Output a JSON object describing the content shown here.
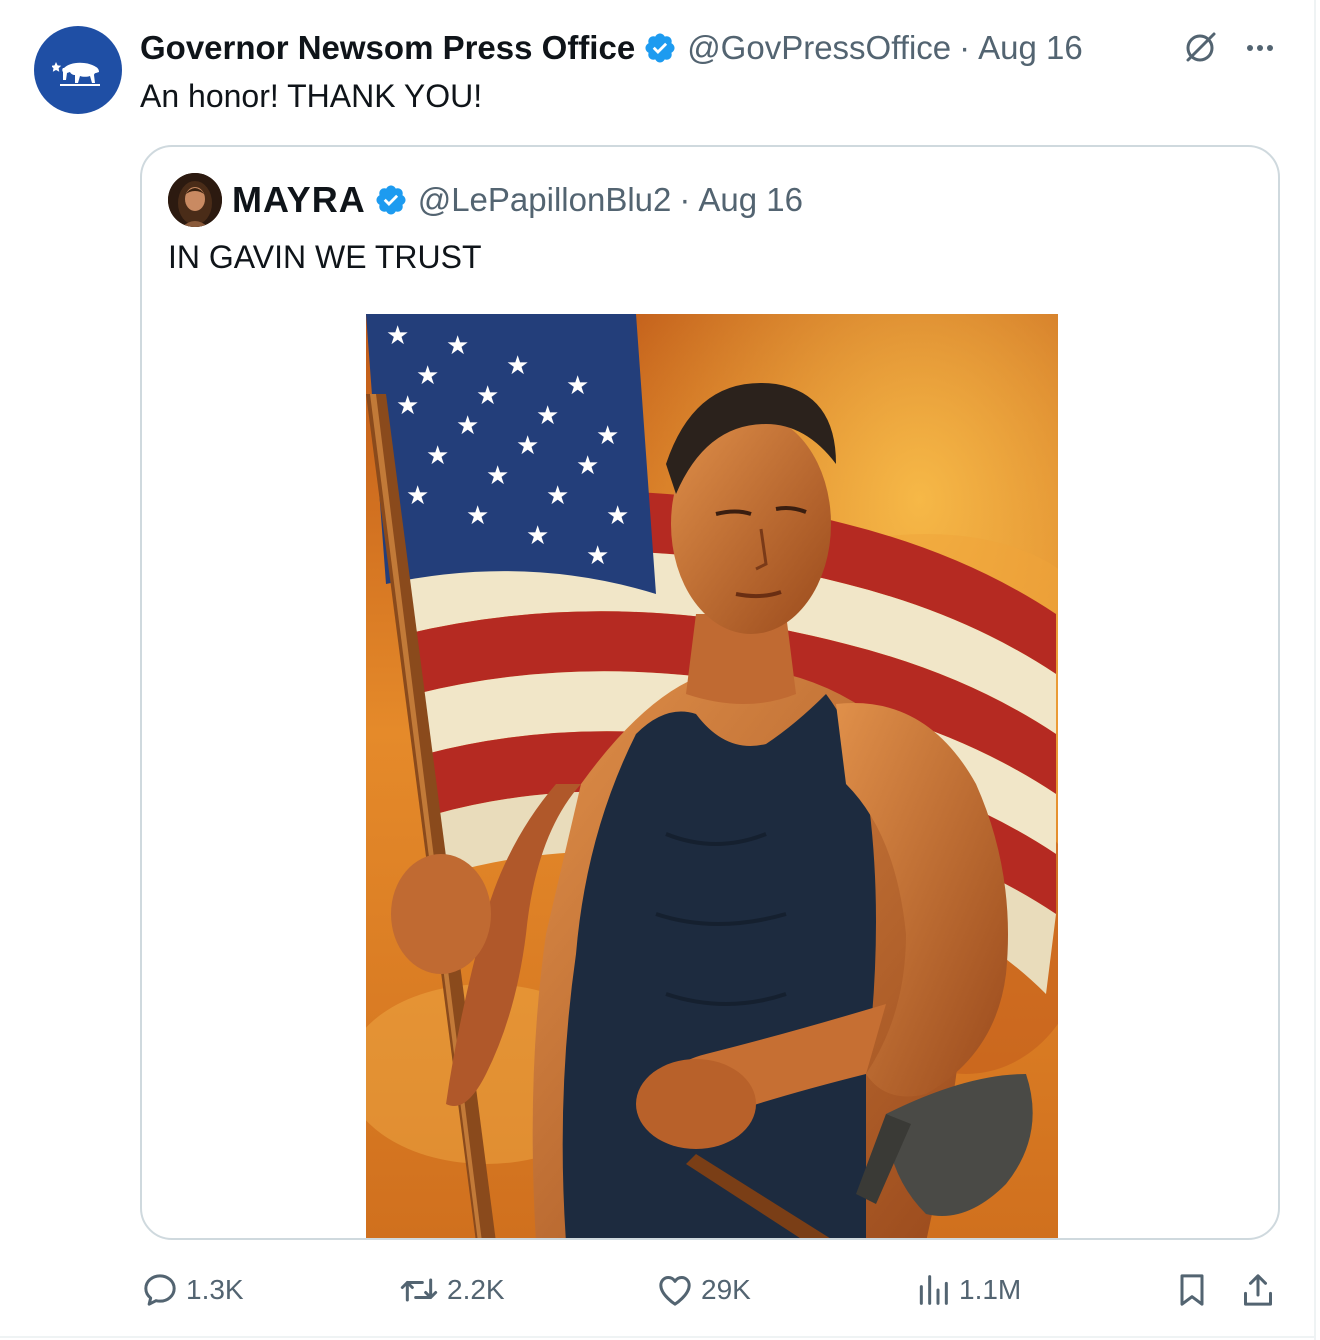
{
  "tweet": {
    "display_name": "Governor Newsom Press Office",
    "handle": "@GovPressOffice",
    "separator": "·",
    "time": "Aug 16",
    "text": "An honor! THANK YOU!"
  },
  "quoted_tweet": {
    "display_name": "MAYRA",
    "handle": "@LePapillonBlu2",
    "separator": "·",
    "time": "Aug 16",
    "text": "IN GAVIN WE TRUST",
    "image_description": "Painted poster of a muscular man in a navy tank top holding an American flag on a pole and a shovel against a fiery orange sky"
  },
  "actions": {
    "replies": "1.3K",
    "reposts": "2.2K",
    "likes": "29K",
    "views": "1.1M"
  },
  "icons": [
    "bear-logo-icon",
    "verified-badge-icon",
    "grok-icon",
    "more-icon",
    "reply-icon",
    "retweet-icon",
    "like-icon",
    "views-icon",
    "bookmark-icon",
    "share-icon"
  ],
  "colors": {
    "accent": "#1d9bf0",
    "muted": "#536471",
    "avatar_bg": "#1f4fa5",
    "border": "#cfd9de"
  }
}
